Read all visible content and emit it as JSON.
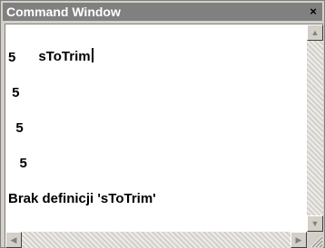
{
  "window": {
    "title": "Command Window",
    "close_glyph": "×"
  },
  "console": {
    "lines": [
      "sToTrim",
      "5",
      " 5",
      "  5",
      "   5",
      "Brak definicji 'sToTrim'"
    ]
  },
  "scroll": {
    "up": "▲",
    "down": "▼",
    "left": "◀",
    "right": "▶"
  },
  "colors": {
    "title_bg": "#808080",
    "title_fg": "#ffffff",
    "content_bg": "#ffffff",
    "chrome": "#d4d0c8"
  }
}
